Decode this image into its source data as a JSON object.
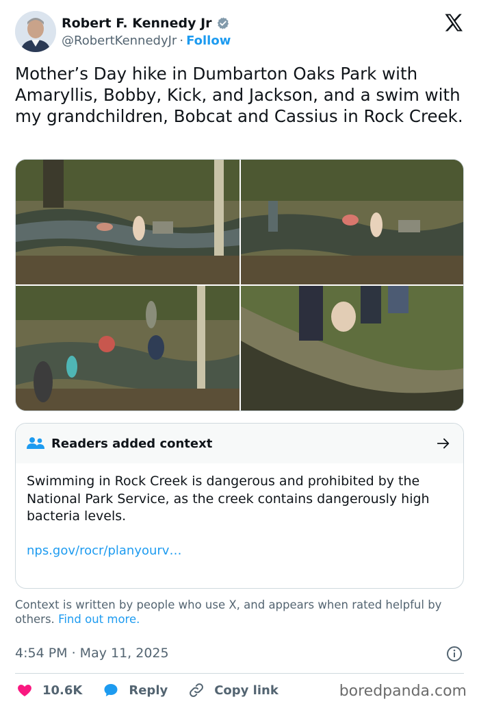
{
  "author": {
    "name": "Robert F. Kennedy Jr",
    "handle": "@RobertKennedyJr",
    "separator": "·",
    "follow_label": "Follow"
  },
  "tweet": {
    "text": "Mother’s Day hike in Dumbarton Oaks Park with Amaryllis, Bobby, Kick, and Jackson, and a swim with my grandchildren, Bobcat and Cassius in Rock Creek."
  },
  "community_note": {
    "title": "Readers added context",
    "body": "Swimming in Rock Creek is dangerous and prohibited by the National Park Service, as the creek contains dangerously high bacteria levels.",
    "link": "nps.gov/rocr/planyourv…"
  },
  "context_footer": {
    "text": "Context is written by people who use X, and appears when rated helpful by others.",
    "link": "Find out more."
  },
  "timestamp": "4:54 PM · May 11, 2025",
  "actions": {
    "likes": "10.6K",
    "reply_label": "Reply",
    "copy_label": "Copy link"
  },
  "watermark": "boredpanda.com",
  "colors": {
    "accent": "#1d9bf0",
    "like": "#f91880",
    "text": "#0f1419",
    "secondary": "#536471"
  }
}
